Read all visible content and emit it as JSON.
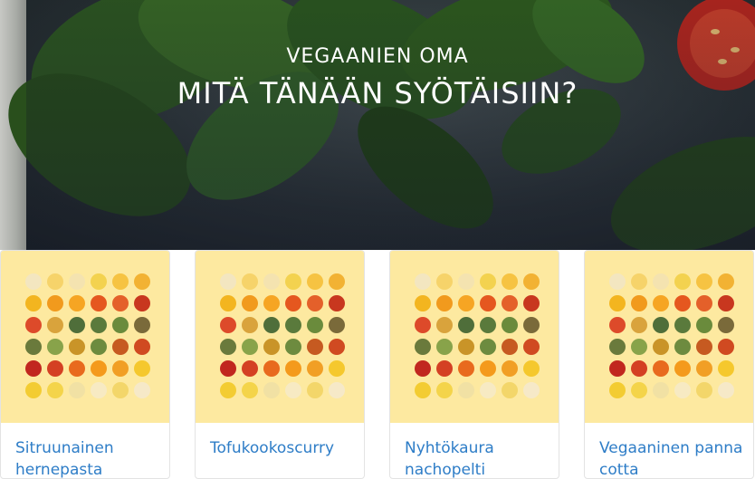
{
  "hero": {
    "kicker": "VEGAANIEN OMA",
    "title": "MITÄ TÄNÄÄN SYÖTÄISIIN?"
  },
  "cards": [
    {
      "title": "Sitruunainen hernepasta"
    },
    {
      "title": "Tofukookoscurry"
    },
    {
      "title": "Nyhtökaura nachopelti"
    },
    {
      "title": "Vegaaninen panna cotta"
    }
  ],
  "colors": {
    "accent_link": "#2e7dc7",
    "card_image_bg": "#fde9a0"
  }
}
